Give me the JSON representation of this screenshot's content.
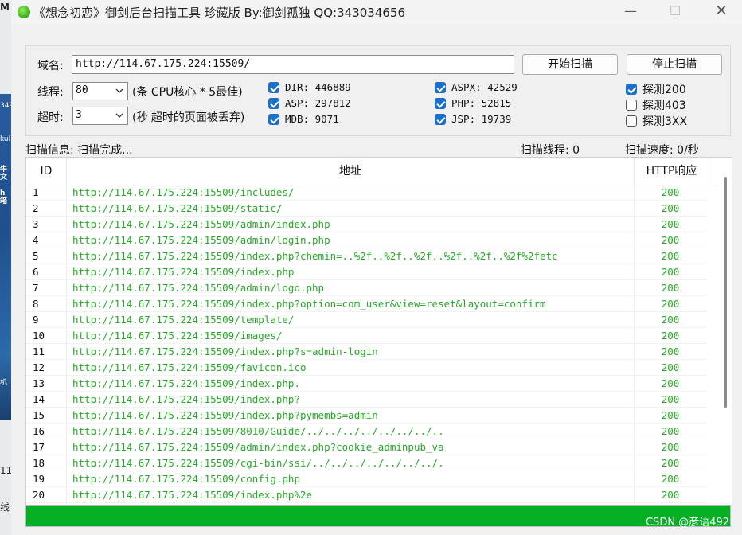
{
  "window": {
    "title": "《想念初恋》御剑后台扫描工具 珍藏版 By:御剑孤独 QQ:343034656",
    "controls": {
      "minimize": "—",
      "maximize": "☐",
      "close": "✕"
    }
  },
  "background_fragments": {
    "a": "349",
    "b": "kul",
    "c": "牛文",
    "d": "h箱",
    "e": "机",
    "f": "11",
    "g": "线",
    "h": "M"
  },
  "form": {
    "domain_label": "域名:",
    "domain_value": "http://114.67.175.224:15509/",
    "threads_label": "线程:",
    "threads_value": "80",
    "threads_hint": "(条 CPU核心 * 5最佳)",
    "timeout_label": "超时:",
    "timeout_value": "3",
    "timeout_hint": "(秒 超时的页面被丢弃)",
    "start_button": "开始扫描",
    "stop_button": "停止扫描"
  },
  "dictionaries": [
    {
      "label": "DIR: 446889",
      "checked": true
    },
    {
      "label": "ASP: 297812",
      "checked": true
    },
    {
      "label": "MDB: 9071",
      "checked": true
    },
    {
      "label": "ASPX: 42529",
      "checked": true
    },
    {
      "label": "PHP: 52815",
      "checked": true
    },
    {
      "label": "JSP: 19739",
      "checked": true
    }
  ],
  "probes": [
    {
      "label": "探测200",
      "checked": true
    },
    {
      "label": "探测403",
      "checked": false
    },
    {
      "label": "探测3XX",
      "checked": false
    }
  ],
  "status": {
    "info": "扫描信息: 扫描完成...",
    "threads": "扫描线程: 0",
    "speed": "扫描速度: 0/秒"
  },
  "table": {
    "columns": [
      "ID",
      "地址",
      "HTTP响应"
    ],
    "rows": [
      {
        "id": "1",
        "url": "http://114.67.175.224:15509/includes/",
        "code": "200"
      },
      {
        "id": "2",
        "url": "http://114.67.175.224:15509/static/",
        "code": "200"
      },
      {
        "id": "3",
        "url": "http://114.67.175.224:15509/admin/index.php",
        "code": "200"
      },
      {
        "id": "4",
        "url": "http://114.67.175.224:15509/admin/login.php",
        "code": "200"
      },
      {
        "id": "5",
        "url": "http://114.67.175.224:15509/index.php?chemin=..%2f..%2f..%2f..%2f..%2f..%2f%2fetc",
        "code": "200"
      },
      {
        "id": "6",
        "url": "http://114.67.175.224:15509/index.php",
        "code": "200"
      },
      {
        "id": "7",
        "url": "http://114.67.175.224:15509/admin/logo.php",
        "code": "200"
      },
      {
        "id": "8",
        "url": "http://114.67.175.224:15509/index.php?option=com_user&view=reset&layout=confirm",
        "code": "200"
      },
      {
        "id": "9",
        "url": "http://114.67.175.224:15509/template/",
        "code": "200"
      },
      {
        "id": "10",
        "url": "http://114.67.175.224:15509/images/",
        "code": "200"
      },
      {
        "id": "11",
        "url": "http://114.67.175.224:15509/index.php?s=admin-login",
        "code": "200"
      },
      {
        "id": "12",
        "url": "http://114.67.175.224:15509/favicon.ico",
        "code": "200"
      },
      {
        "id": "13",
        "url": "http://114.67.175.224:15509/index.php.",
        "code": "200"
      },
      {
        "id": "14",
        "url": "http://114.67.175.224:15509/index.php?",
        "code": "200"
      },
      {
        "id": "15",
        "url": "http://114.67.175.224:15509/index.php?pymembs=admin",
        "code": "200"
      },
      {
        "id": "16",
        "url": "http://114.67.175.224:15509/8010/Guide/../../../../../../../..",
        "code": "200"
      },
      {
        "id": "17",
        "url": "http://114.67.175.224:15509/admin/index.php?cookie_adminpub_va",
        "code": "200"
      },
      {
        "id": "18",
        "url": "http://114.67.175.224:15509/cgi-bin/ssi/../../../../../../../.",
        "code": "200"
      },
      {
        "id": "19",
        "url": "http://114.67.175.224:15509/config.php",
        "code": "200"
      },
      {
        "id": "20",
        "url": "http://114.67.175.224:15509/index.php%2e",
        "code": "200"
      }
    ]
  },
  "progress": {
    "percent": 100,
    "color": "#06b025"
  },
  "watermark": "CSDN @彦语492"
}
